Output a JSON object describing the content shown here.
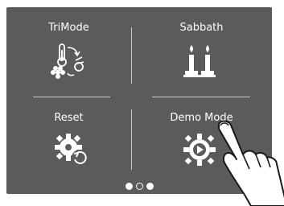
{
  "menu": {
    "tiles": [
      {
        "label": "TriMode",
        "icon": "trimode-icon"
      },
      {
        "label": "Sabbath",
        "icon": "candles-icon"
      },
      {
        "label": "Reset",
        "icon": "reset-gear-icon"
      },
      {
        "label": "Demo Mode",
        "icon": "demo-gear-play-icon"
      }
    ]
  },
  "pager": {
    "pages": 3,
    "current": 1
  },
  "colors": {
    "screen_bg": "#5a5b5d",
    "text": "#ffffff",
    "divider": "#c9cacb"
  }
}
